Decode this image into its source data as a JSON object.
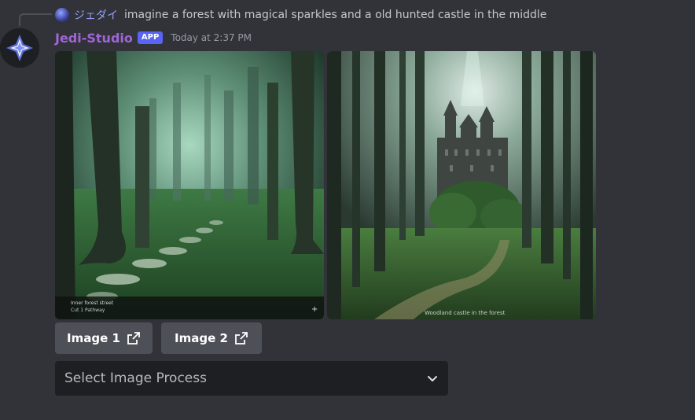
{
  "reply": {
    "username": "ジェダイ",
    "text": "imagine a forest with magical sparkles and a old hunted castle in the middle"
  },
  "message": {
    "author": "Jedi-Studio",
    "badge": "APP",
    "timestamp": "Today at 2:37 PM"
  },
  "images": [
    {
      "caption_line_1": "Inner forest street",
      "caption_line_2": "Cut 1  Pathway",
      "plus": "+"
    },
    {
      "watermark": "Woodland castle in the forest"
    }
  ],
  "buttons": [
    {
      "label": "Image 1",
      "icon": "external-link-icon"
    },
    {
      "label": "Image 2",
      "icon": "external-link-icon"
    }
  ],
  "select": {
    "placeholder": "Select Image Process",
    "icon": "chevron-down-icon"
  },
  "colors": {
    "background": "#313338",
    "author": "#a065d8",
    "badge": "#5865f2",
    "button": "#4e5058",
    "select_bg": "#1e1f22"
  }
}
